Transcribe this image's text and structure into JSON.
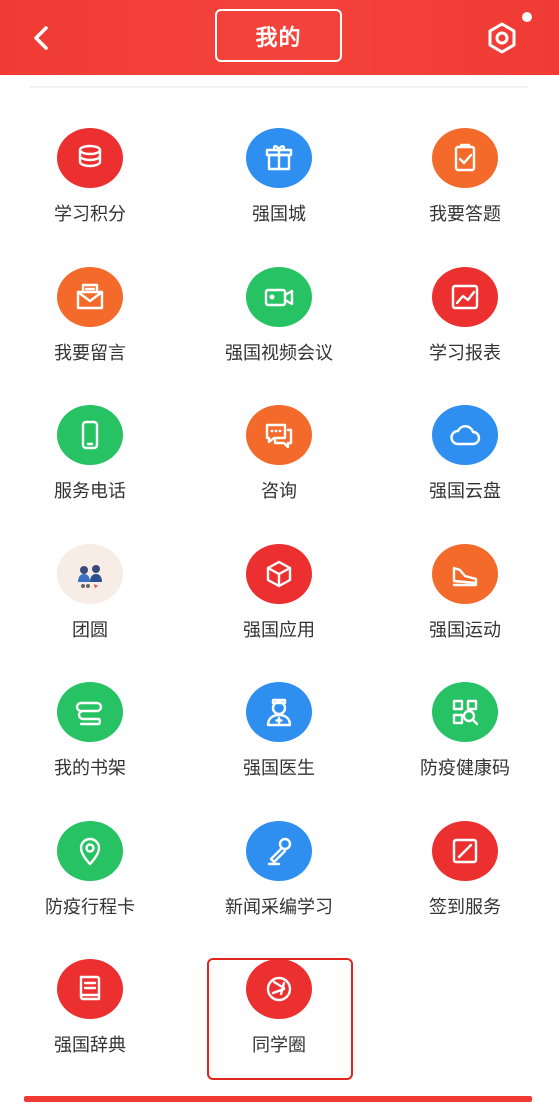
{
  "header": {
    "title": "我的"
  },
  "colors": {
    "header_red": "#ef3b34",
    "highlight": "#e0251c"
  },
  "menu": [
    {
      "label": "学习积分",
      "icon": "coins-stack-icon",
      "color": "#ec3030"
    },
    {
      "label": "强国城",
      "icon": "gift-box-icon",
      "color": "#2e8ff0"
    },
    {
      "label": "我要答题",
      "icon": "clipboard-icon",
      "color": "#f36a2a"
    },
    {
      "label": "我要留言",
      "icon": "envelope-icon",
      "color": "#f36a2a"
    },
    {
      "label": "强国视频会议",
      "icon": "video-camera-icon",
      "color": "#27c264"
    },
    {
      "label": "学习报表",
      "icon": "chart-icon",
      "color": "#ec3030"
    },
    {
      "label": "服务电话",
      "icon": "phone-icon",
      "color": "#27c264"
    },
    {
      "label": "咨询",
      "icon": "chat-bubbles-icon",
      "color": "#f36a2a"
    },
    {
      "label": "强国云盘",
      "icon": "cloud-icon",
      "color": "#2e8ff0"
    },
    {
      "label": "团圆",
      "icon": "reunion-illustration-icon",
      "color": "#f7ece6"
    },
    {
      "label": "强国应用",
      "icon": "cube-icon",
      "color": "#ec3030"
    },
    {
      "label": "强国运动",
      "icon": "shoe-icon",
      "color": "#f36a2a"
    },
    {
      "label": "我的书架",
      "icon": "books-icon",
      "color": "#27c264"
    },
    {
      "label": "强国医生",
      "icon": "doctor-icon",
      "color": "#2e8ff0"
    },
    {
      "label": "防疫健康码",
      "icon": "qr-code-icon",
      "color": "#27c264"
    },
    {
      "label": "防疫行程卡",
      "icon": "location-pin-icon",
      "color": "#27c264"
    },
    {
      "label": "新闻采编学习",
      "icon": "microphone-icon",
      "color": "#2e8ff0"
    },
    {
      "label": "签到服务",
      "icon": "sign-in-icon",
      "color": "#ec3030"
    },
    {
      "label": "强国辞典",
      "icon": "dictionary-icon",
      "color": "#ec3030"
    },
    {
      "label": "同学圈",
      "icon": "circle-ring-icon",
      "color": "#ec3030"
    }
  ]
}
